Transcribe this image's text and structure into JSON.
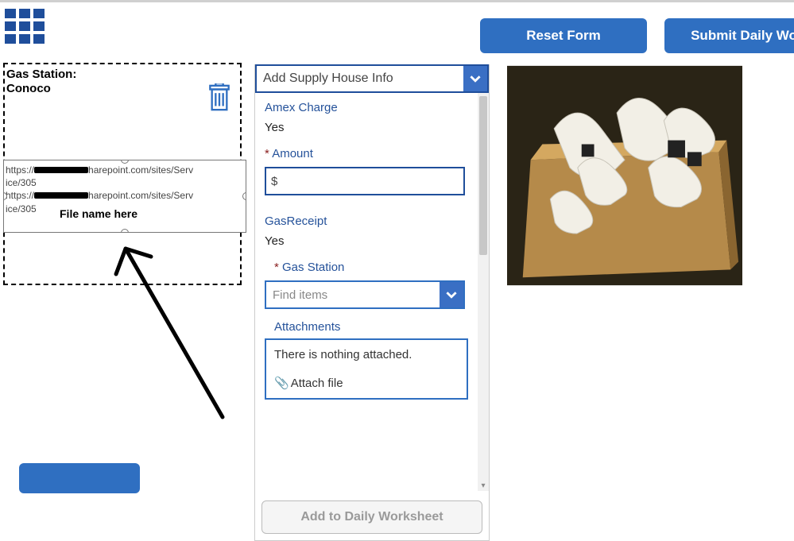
{
  "header": {
    "reset_label": "Reset Form",
    "submit_label": "Submit Daily Wo"
  },
  "card": {
    "title_line1": "Gas Station:",
    "title_line2": "Conoco",
    "url1_a": "https://",
    "url1_b": "harepoint.com/sites/Serv",
    "url1_c": "ice/305",
    "url2_a": "https://",
    "url2_b": "harepoint.com/sites/Serv",
    "url2_c": "ice/305",
    "file_annot": "File name here"
  },
  "form": {
    "select_header": "Add Supply House Info",
    "amex_label": "Amex Charge",
    "amex_value": "Yes",
    "amount_label": "Amount",
    "amount_value": "$",
    "gas_receipt_label": "GasReceipt",
    "gas_receipt_value": "Yes",
    "gas_station_label": "Gas Station",
    "find_items_placeholder": "Find items",
    "attachments_label": "Attachments",
    "attachments_empty": "There is nothing attached.",
    "attach_action": "Attach file",
    "add_label": "Add to Daily Worksheet"
  }
}
